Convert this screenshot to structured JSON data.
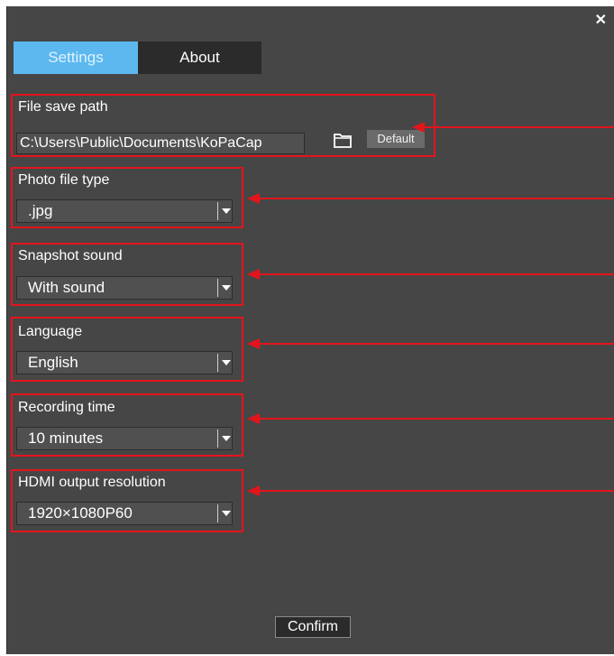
{
  "window": {
    "close_glyph": "✕"
  },
  "tabs": [
    {
      "label": "Settings",
      "active": true
    },
    {
      "label": "About",
      "active": false
    }
  ],
  "file_save_path": {
    "label": "File save path",
    "value": "C:\\Users\\Public\\Documents\\KoPaCap",
    "default_label": "Default",
    "folder_icon": "folder-open-icon"
  },
  "photo_file_type": {
    "label": "Photo file type",
    "value": ".jpg"
  },
  "snapshot_sound": {
    "label": "Snapshot sound",
    "value": "With sound"
  },
  "language": {
    "label": "Language",
    "value": "English"
  },
  "recording_time": {
    "label": "Recording time",
    "value": "10 minutes"
  },
  "hdmi_output_resolution": {
    "label": "HDMI output resolution",
    "value": "1920×1080P60"
  },
  "confirm_label": "Confirm",
  "colors": {
    "window_bg": "#464646",
    "tab_active": "#5cb8ef",
    "tab_inactive": "#2b2b2b",
    "annotation_red": "#e4141c"
  }
}
